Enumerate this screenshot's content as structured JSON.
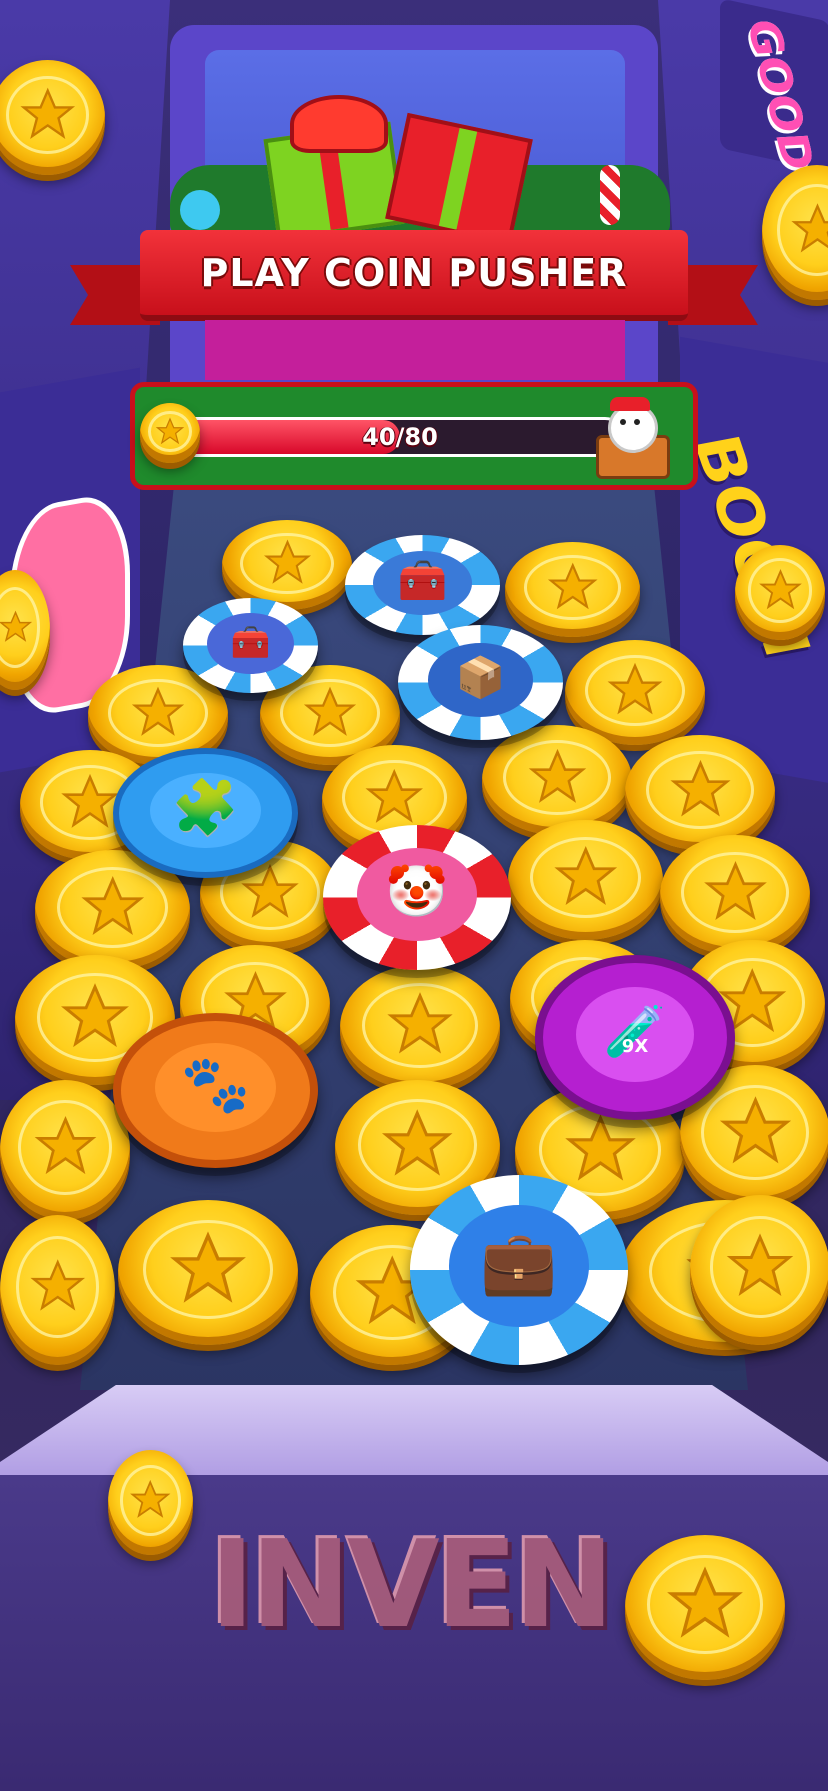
{
  "header": {
    "title": "PLAY COIN PUSHER"
  },
  "progress": {
    "text": "40/80",
    "current": 40,
    "max": 80
  },
  "decor": {
    "graffiti_bottom": "INVEN",
    "graffiti_right": "BOOM",
    "graffiti_top_right": "GOOD"
  },
  "colors": {
    "banner_red": "#d4141d",
    "progress_fill": "#e8102a",
    "progress_panel": "#1f8a2c",
    "coin_gold": "#ffcf1c",
    "machine_purple": "#5b46c9"
  },
  "icons": {
    "goal_chest": "snowman-gift-chest-icon",
    "puzzle": "puzzle-piece-icon",
    "clown": "clown-card-icon",
    "potion": "potion-9x-icon",
    "bag": "pet-food-bag-icon",
    "briefcase": "briefcase-icon",
    "chest_blue": "blue-chest-icon",
    "chest_orange": "orange-chest-icon",
    "chest_purple": "purple-chest-icon"
  },
  "potion_label": "9X"
}
